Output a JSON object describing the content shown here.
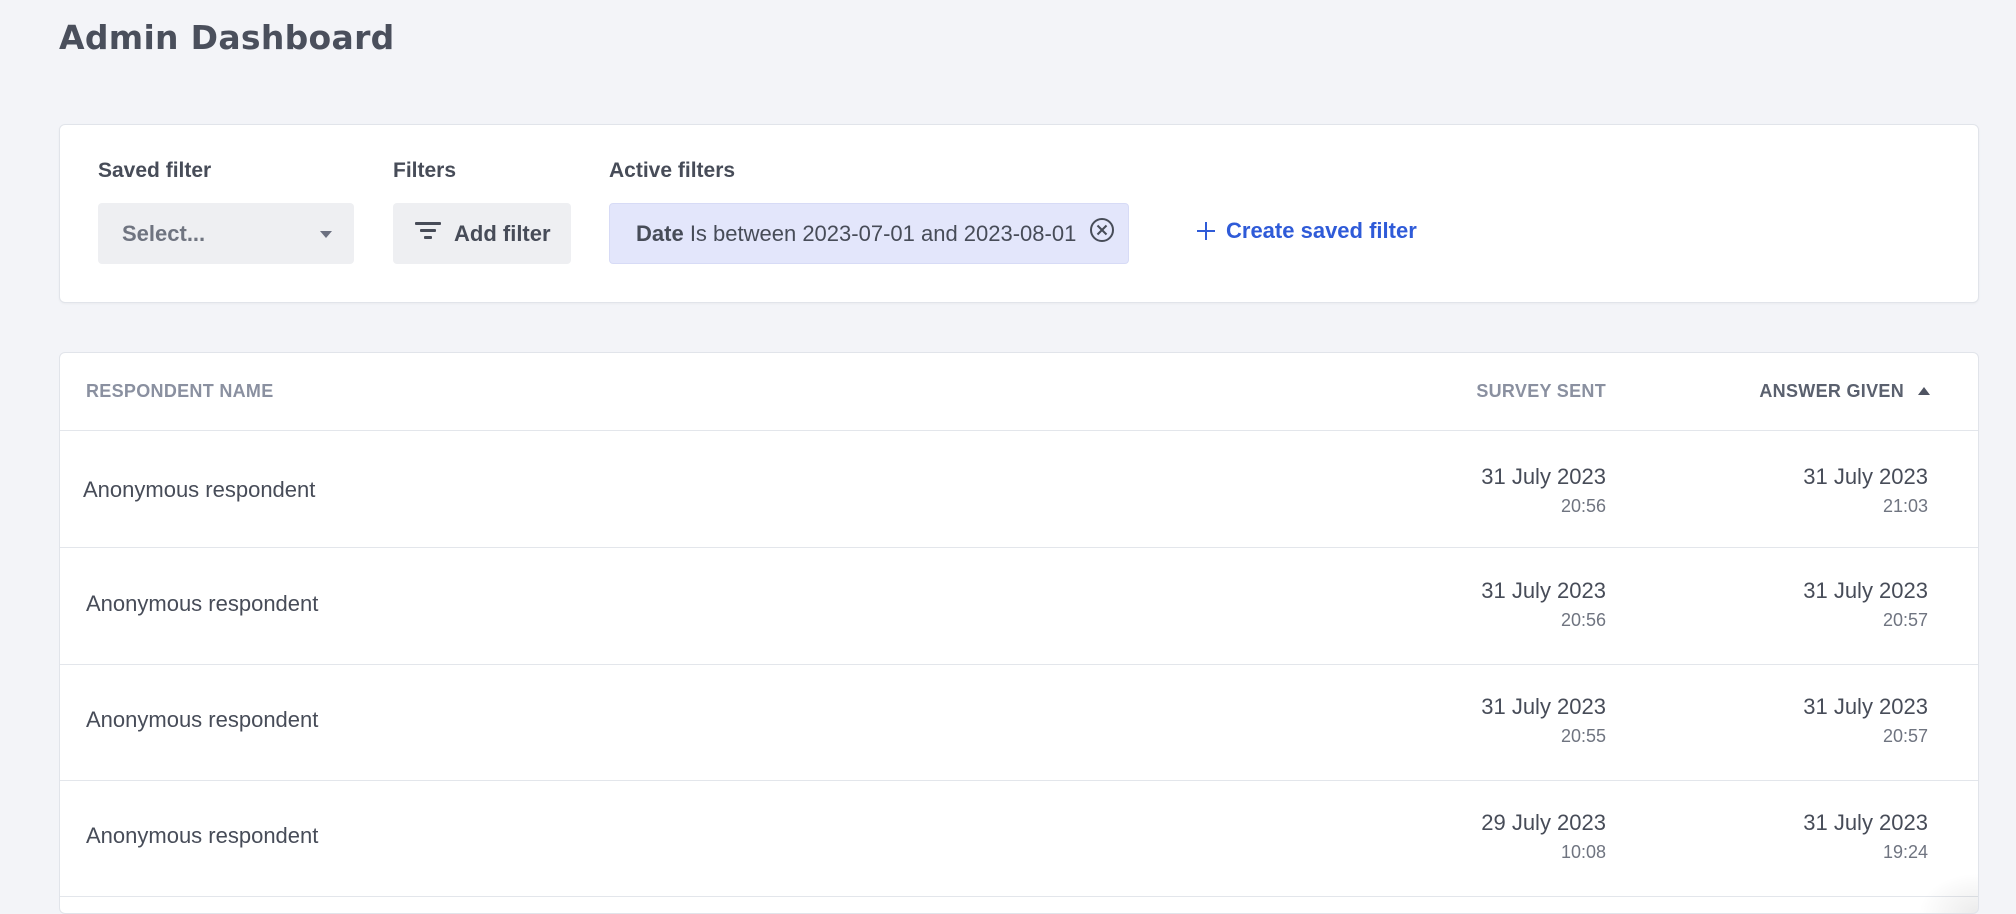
{
  "page": {
    "title": "Admin Dashboard"
  },
  "filters": {
    "saved_filter_label": "Saved filter",
    "saved_filter_placeholder": "Select...",
    "filters_label": "Filters",
    "add_filter_label": "Add filter",
    "active_filters_label": "Active filters",
    "active": [
      {
        "field": "Date",
        "condition": "Is between 2023-07-01 and 2023-08-01"
      }
    ],
    "create_saved_filter_label": "Create saved filter",
    "accent_color": "#2f5bd8",
    "chip_color": "#e3e6fb"
  },
  "table": {
    "columns": {
      "name": "RESPONDENT NAME",
      "survey_sent": "SURVEY SENT",
      "answer_given": "ANSWER GIVEN"
    },
    "sort": {
      "column": "answer_given",
      "direction": "ascending"
    },
    "rows": [
      {
        "name": "Anonymous respondent",
        "sent_date": "31 July 2023",
        "sent_time": "20:56",
        "answer_date": "31 July 2023",
        "answer_time": "21:03"
      },
      {
        "name": "Anonymous respondent",
        "sent_date": "31 July 2023",
        "sent_time": "20:56",
        "answer_date": "31 July 2023",
        "answer_time": "20:57"
      },
      {
        "name": "Anonymous respondent",
        "sent_date": "31 July 2023",
        "sent_time": "20:55",
        "answer_date": "31 July 2023",
        "answer_time": "20:57"
      },
      {
        "name": "Anonymous respondent",
        "sent_date": "29 July 2023",
        "sent_time": "10:08",
        "answer_date": "31 July 2023",
        "answer_time": "19:24"
      }
    ]
  }
}
